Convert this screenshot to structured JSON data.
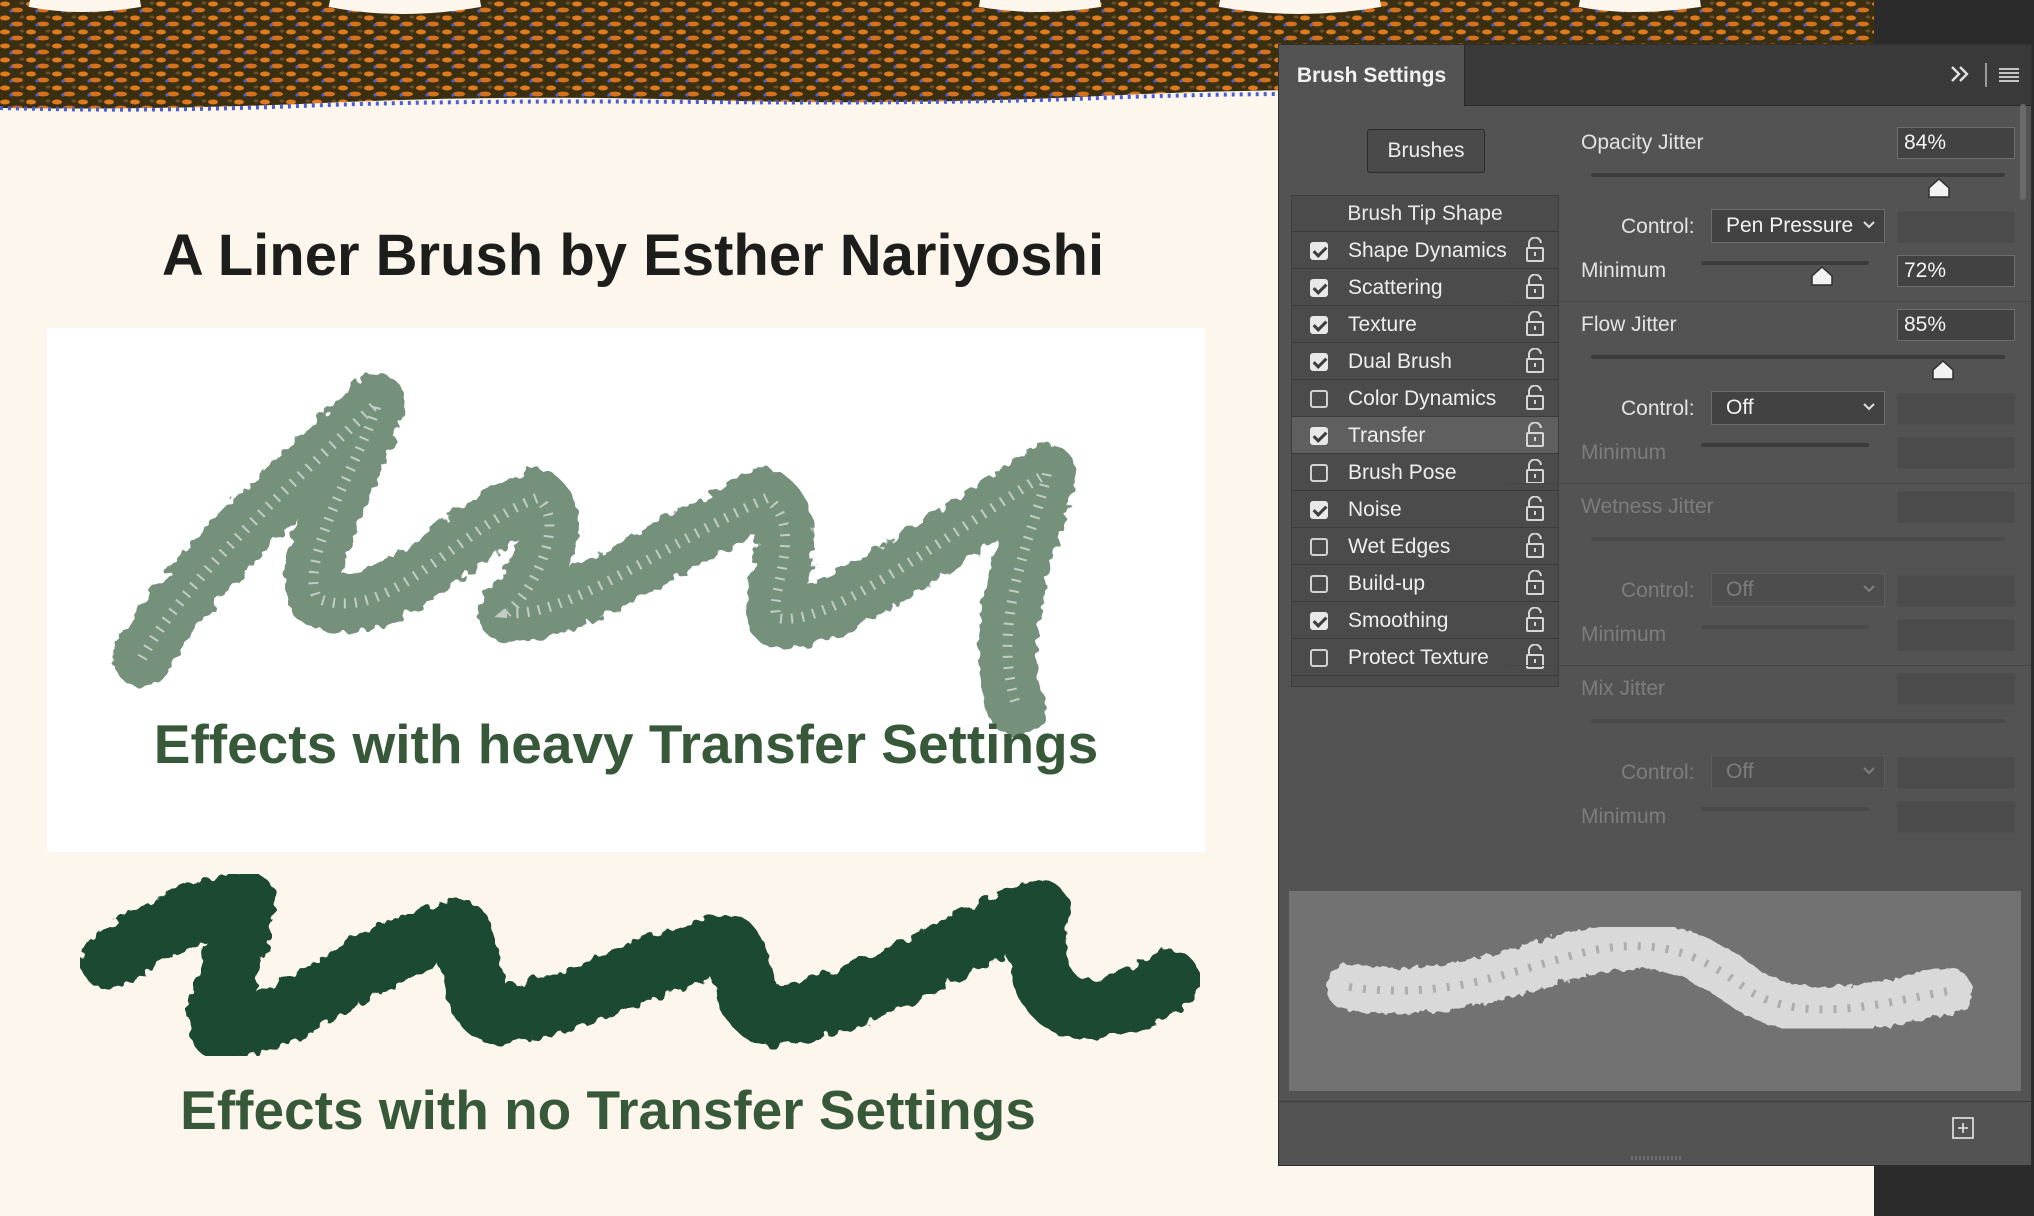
{
  "canvas": {
    "title": "A Liner Brush by Esther Nariyoshi",
    "heavy_caption": "Effects with heavy Transfer Settings",
    "none_caption": "Effects with no Transfer Settings",
    "colors": {
      "background": "#fdf6ec",
      "stroke_dark": "#1f4a33",
      "stroke_light": "#5d7e66",
      "caption": "#37593a",
      "banner_dark": "#3b2f12",
      "banner_orange": "#e07a1f",
      "banner_blue": "#4a5fd0"
    }
  },
  "panel": {
    "tab_title": "Brush Settings",
    "collapse_icon": "double-chevron-right-icon",
    "menu_icon": "hamburger-menu-icon",
    "brushes_button": "Brushes",
    "tip_shape": "Brush Tip Shape",
    "options": [
      {
        "label": "Shape Dynamics",
        "checked": true
      },
      {
        "label": "Scattering",
        "checked": true
      },
      {
        "label": "Texture",
        "checked": true
      },
      {
        "label": "Dual Brush",
        "checked": true
      },
      {
        "label": "Color Dynamics",
        "checked": false
      },
      {
        "label": "Transfer",
        "checked": true,
        "selected": true
      },
      {
        "label": "Brush Pose",
        "checked": false
      },
      {
        "label": "Noise",
        "checked": true
      },
      {
        "label": "Wet Edges",
        "checked": false
      },
      {
        "label": "Build-up",
        "checked": false
      },
      {
        "label": "Smoothing",
        "checked": true
      },
      {
        "label": "Protect Texture",
        "checked": false
      }
    ],
    "transfer": {
      "opacity_jitter": {
        "label": "Opacity Jitter",
        "value": "84%",
        "level": 0.84
      },
      "opacity_control": {
        "label": "Control:",
        "value": "Pen Pressure"
      },
      "opacity_minimum": {
        "label": "Minimum",
        "value": "72%",
        "level": 0.72
      },
      "flow_jitter": {
        "label": "Flow Jitter",
        "value": "85%",
        "level": 0.85
      },
      "flow_control": {
        "label": "Control:",
        "value": "Off"
      },
      "flow_minimum": {
        "label": "Minimum"
      },
      "wetness_jitter": {
        "label": "Wetness Jitter"
      },
      "wetness_control": {
        "label": "Control:",
        "value": "Off"
      },
      "wetness_minimum": {
        "label": "Minimum"
      },
      "mix_jitter": {
        "label": "Mix Jitter"
      },
      "mix_control": {
        "label": "Control:",
        "value": "Off"
      },
      "mix_minimum": {
        "label": "Minimum"
      }
    },
    "footer_icon": "new-preset-icon"
  }
}
